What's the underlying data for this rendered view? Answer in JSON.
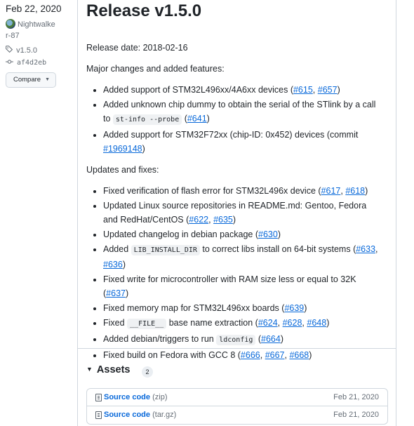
{
  "sidebar": {
    "date": "Feb 22, 2020",
    "author_line1": "Nightwalke",
    "author_line2": "r-87",
    "tag": "v1.5.0",
    "commit": "af4d2eb",
    "compare_label": "Compare"
  },
  "release": {
    "title": "Release v1.5.0",
    "release_date": "Release date: 2018-02-16",
    "major_heading": "Major changes and added features:",
    "updates_heading": "Updates and fixes:",
    "major": [
      {
        "pre": "Added support of STM32L496xx/4A6xx devices (",
        "links": [
          "#615",
          "#657"
        ],
        "post": ")"
      },
      {
        "pre": "Added unknown chip dummy to obtain the serial of the STlink by a call to ",
        "code": "st-info --probe",
        "mid": " (",
        "links": [
          "#641"
        ],
        "post": ")"
      },
      {
        "pre": "Added support for STM32F72xx (chip-ID: 0x452) devices (commit ",
        "links": [
          "#1969148"
        ],
        "post": ")"
      }
    ],
    "updates": [
      {
        "pre": "Fixed verification of flash error for STM32L496x device (",
        "links": [
          "#617",
          "#618"
        ],
        "post": ")"
      },
      {
        "pre": "Updated Linux source repositories in README.md: Gentoo, Fedora and RedHat/CentOS (",
        "links": [
          "#622",
          "#635"
        ],
        "post": ")"
      },
      {
        "pre": "Updated changelog in debian package (",
        "links": [
          "#630"
        ],
        "post": ")"
      },
      {
        "pre": "Added ",
        "code": "LIB_INSTALL_DIR",
        "mid": " to correct libs install on 64-bit systems (",
        "links": [
          "#633",
          "#636"
        ],
        "post": ")"
      },
      {
        "pre": "Fixed write for microcontroller with RAM size less or equal to 32K (",
        "links": [
          "#637"
        ],
        "post": ")"
      },
      {
        "pre": "Fixed memory map for STM32L496xx boards (",
        "links": [
          "#639"
        ],
        "post": ")"
      },
      {
        "pre": "Fixed ",
        "code": "__FILE__",
        "mid": " base name extraction (",
        "links": [
          "#624",
          "#628",
          "#648"
        ],
        "post": ")"
      },
      {
        "pre": "Added debian/triggers to run ",
        "code": "ldconfig",
        "mid": " (",
        "links": [
          "#664"
        ],
        "post": ")"
      },
      {
        "pre": "Fixed build on Fedora with GCC 8 (",
        "links": [
          "#666",
          "#667",
          "#668"
        ],
        "post": ")"
      }
    ]
  },
  "assets": {
    "heading": "Assets",
    "count": "2",
    "items": [
      {
        "name": "Source code",
        "ext": "(zip)",
        "date": "Feb 21, 2020"
      },
      {
        "name": "Source code",
        "ext": "(tar.gz)",
        "date": "Feb 21, 2020"
      }
    ]
  }
}
